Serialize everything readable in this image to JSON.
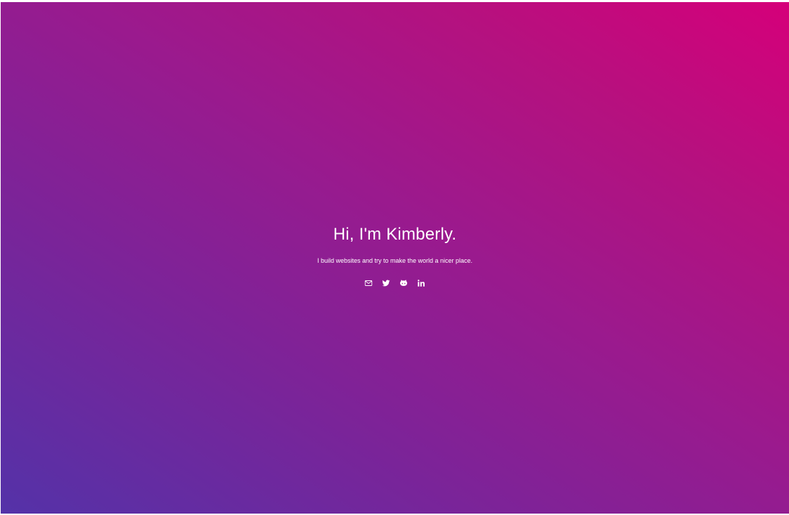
{
  "hero": {
    "title": "Hi, I'm Kimberly.",
    "tagline": "I build websites and try to make the world a nicer place."
  },
  "socials": [
    {
      "name": "email",
      "icon": "mail-icon"
    },
    {
      "name": "twitter",
      "icon": "twitter-icon"
    },
    {
      "name": "github",
      "icon": "github-icon"
    },
    {
      "name": "linkedin",
      "icon": "linkedin-icon"
    }
  ],
  "colors": {
    "gradient_start": "#5432a8",
    "gradient_end": "#d5007a",
    "text": "#ffffff"
  }
}
